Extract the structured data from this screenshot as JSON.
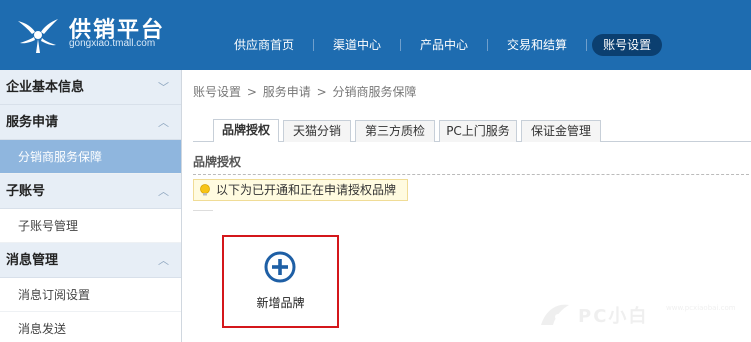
{
  "header": {
    "brand_title": "供销平台",
    "brand_subtitle": "gongxiao.tmall.com",
    "nav": [
      {
        "label": "供应商首页"
      },
      {
        "label": "渠道中心"
      },
      {
        "label": "产品中心"
      },
      {
        "label": "交易和结算"
      },
      {
        "label": "账号设置",
        "active": true
      }
    ]
  },
  "sidebar": {
    "sections": [
      {
        "label": "企业基本信息",
        "expanded": false,
        "items": []
      },
      {
        "label": "服务申请",
        "expanded": true,
        "items": [
          {
            "label": "分销商服务保障",
            "active": true
          }
        ]
      },
      {
        "label": "子账号",
        "expanded": true,
        "items": [
          {
            "label": "子账号管理"
          }
        ]
      },
      {
        "label": "消息管理",
        "expanded": true,
        "items": [
          {
            "label": "消息订阅设置"
          },
          {
            "label": "消息发送"
          }
        ]
      }
    ]
  },
  "breadcrumb": [
    "账号设置",
    ">",
    "服务申请",
    ">",
    "分销商服务保障"
  ],
  "tabs": [
    {
      "label": "品牌授权",
      "active": true
    },
    {
      "label": "天猫分销"
    },
    {
      "label": "第三方质检"
    },
    {
      "label": "PC上门服务"
    },
    {
      "label": "保证金管理"
    }
  ],
  "section_title": "品牌授权",
  "notice": "以下为已开通和正在申请授权品牌",
  "add_brand_label": "新增品牌",
  "watermark": {
    "text": "PC小白",
    "small": "www.pcxiaobai.com"
  },
  "colors": {
    "header_bg": "#1e6cb0",
    "active_sidebar": "#8fb6de",
    "highlight_border": "#d4171b",
    "add_icon": "#1e5fa5"
  }
}
